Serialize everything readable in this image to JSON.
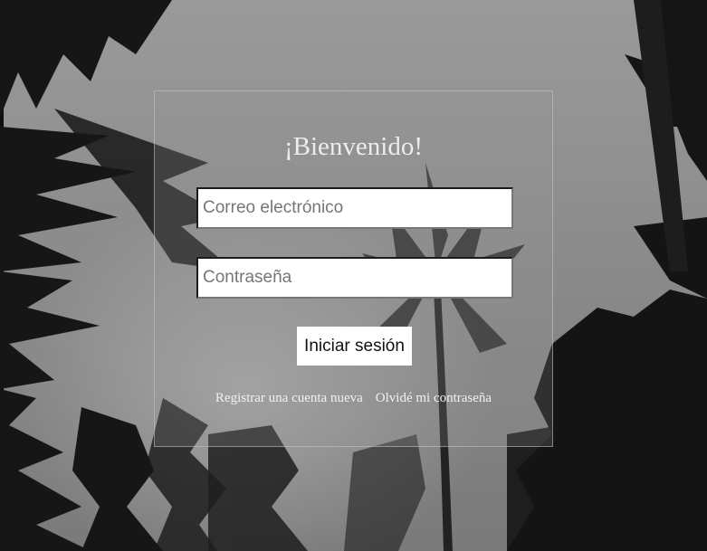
{
  "login": {
    "title": "¡Bienvenido!",
    "email_placeholder": "Correo electrónico",
    "password_placeholder": "Contraseña",
    "submit_label": "Iniciar sesión",
    "register_link": "Registrar una cuenta nueva",
    "forgot_link": "Olvidé mi contraseña"
  },
  "background": {
    "description_icon": "palm-trees-photo",
    "tone": "grayscale"
  },
  "colors": {
    "sky": "#8a8a8a",
    "foliage": "#151515",
    "text_light": "#ededed",
    "button_bg": "#ffffff"
  }
}
